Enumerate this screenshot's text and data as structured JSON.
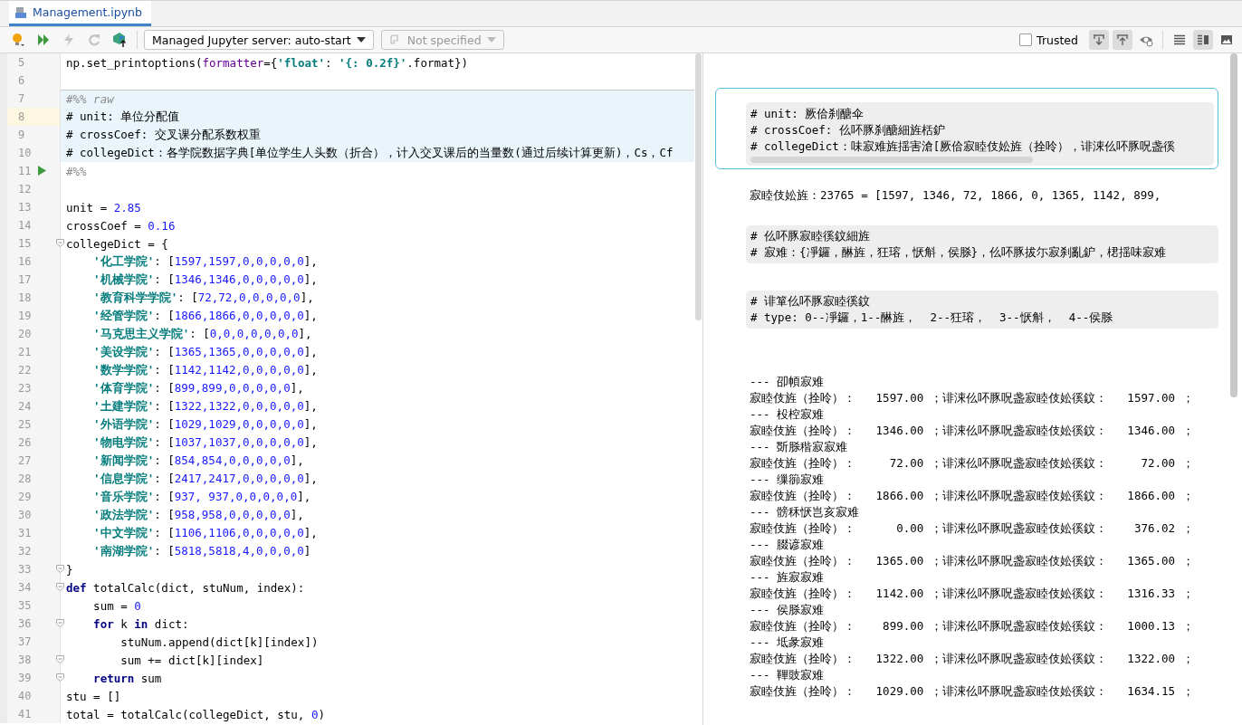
{
  "tabs": [
    {
      "label": "Management.ipynb",
      "selected": true
    }
  ],
  "toolbar": {
    "buttons": [
      {
        "kind": "bulb",
        "disabled": false
      },
      {
        "kind": "run-all",
        "disabled": false
      },
      {
        "kind": "interrupt",
        "disabled": true
      },
      {
        "kind": "restart",
        "disabled": true
      },
      {
        "kind": "jupyter",
        "disabled": false
      }
    ],
    "server_dropdown": {
      "label": "Managed Jupyter server: auto-start",
      "disabled": false
    },
    "kernel_dropdown": {
      "label": "Not specified",
      "disabled": true
    },
    "trusted": {
      "label": "Trusted",
      "checked": false
    },
    "actions": [
      {
        "kind": "move-down",
        "on": true
      },
      {
        "kind": "move-up",
        "on": true
      },
      {
        "kind": "eye",
        "on": false
      }
    ],
    "views": [
      {
        "kind": "editor",
        "selected": false
      },
      {
        "kind": "split",
        "selected": true
      },
      {
        "kind": "preview",
        "selected": false
      }
    ]
  },
  "editor": {
    "lines": [
      {
        "number": "5",
        "raw": false,
        "current": false,
        "segments": [
          {
            "kind": "plain",
            "text": "np.set_printoptions("
          },
          {
            "kind": "arg",
            "text": "formatter"
          },
          {
            "kind": "plain",
            "text": "={"
          },
          {
            "kind": "str",
            "text": "'float'"
          },
          {
            "kind": "plain",
            "text": ": "
          },
          {
            "kind": "str",
            "text": "'{: 0.2f}'"
          },
          {
            "kind": "plain",
            "text": ".format})"
          }
        ]
      },
      {
        "number": "6",
        "raw": false,
        "current": false
      },
      {
        "number": "7",
        "raw": true,
        "current": false,
        "segments": [
          {
            "kind": "comment",
            "text": "#%% raw"
          }
        ]
      },
      {
        "number": "8",
        "raw": true,
        "current": true,
        "segments": [
          {
            "kind": "plain",
            "text": "# unit: 单位分配值"
          }
        ]
      },
      {
        "number": "9",
        "raw": true,
        "current": false,
        "segments": [
          {
            "kind": "plain",
            "text": "# crossCoef: 交叉课分配系数权重"
          }
        ]
      },
      {
        "number": "10",
        "raw": true,
        "current": false,
        "segments": [
          {
            "kind": "plain",
            "text": "# collegeDict：各学院数据字典[单位学生人头数（折合），计入交叉课后的当量数(通过后续计算更新)，Cs，Cf"
          }
        ]
      },
      {
        "number": "11",
        "raw": false,
        "current": false,
        "run": true,
        "segments": [
          {
            "kind": "comment",
            "text": "#%%"
          }
        ]
      },
      {
        "number": "12",
        "raw": false,
        "current": false
      },
      {
        "number": "13",
        "raw": false,
        "current": false,
        "segments": [
          {
            "kind": "plain",
            "text": "unit = "
          },
          {
            "kind": "num",
            "text": "2.85"
          }
        ]
      },
      {
        "number": "14",
        "raw": false,
        "current": false,
        "segments": [
          {
            "kind": "plain",
            "text": "crossCoef = "
          },
          {
            "kind": "num",
            "text": "0.16"
          }
        ]
      },
      {
        "number": "15",
        "raw": false,
        "current": false,
        "fold": true,
        "segments": [
          {
            "kind": "plain",
            "text": "collegeDict = {"
          }
        ]
      },
      {
        "number": "16",
        "raw": false,
        "current": false,
        "segments": [
          {
            "kind": "str",
            "text": "    '化工学院'"
          },
          {
            "kind": "plain",
            "text": ": ["
          },
          {
            "kind": "num",
            "text": "1597,1597,0,0,0,0,0"
          },
          {
            "kind": "plain",
            "text": "],"
          }
        ]
      },
      {
        "number": "17",
        "raw": false,
        "current": false,
        "segments": [
          {
            "kind": "str",
            "text": "    '机械学院'"
          },
          {
            "kind": "plain",
            "text": ": ["
          },
          {
            "kind": "num",
            "text": "1346,1346,0,0,0,0,0"
          },
          {
            "kind": "plain",
            "text": "],"
          }
        ]
      },
      {
        "number": "18",
        "raw": false,
        "current": false,
        "segments": [
          {
            "kind": "str",
            "text": "    '教育科学学院'"
          },
          {
            "kind": "plain",
            "text": ": ["
          },
          {
            "kind": "num",
            "text": "72,72,0,0,0,0,0"
          },
          {
            "kind": "plain",
            "text": "],"
          }
        ]
      },
      {
        "number": "19",
        "raw": false,
        "current": false,
        "segments": [
          {
            "kind": "str",
            "text": "    '经管学院'"
          },
          {
            "kind": "plain",
            "text": ": ["
          },
          {
            "kind": "num",
            "text": "1866,1866,0,0,0,0,0"
          },
          {
            "kind": "plain",
            "text": "],"
          }
        ]
      },
      {
        "number": "20",
        "raw": false,
        "current": false,
        "segments": [
          {
            "kind": "str",
            "text": "    '马克思主义学院'"
          },
          {
            "kind": "plain",
            "text": ": ["
          },
          {
            "kind": "num",
            "text": "0,0,0,0,0,0,0"
          },
          {
            "kind": "plain",
            "text": "],"
          }
        ]
      },
      {
        "number": "21",
        "raw": false,
        "current": false,
        "segments": [
          {
            "kind": "str",
            "text": "    '美设学院'"
          },
          {
            "kind": "plain",
            "text": ": ["
          },
          {
            "kind": "num",
            "text": "1365,1365,0,0,0,0,0"
          },
          {
            "kind": "plain",
            "text": "],"
          }
        ]
      },
      {
        "number": "22",
        "raw": false,
        "current": false,
        "segments": [
          {
            "kind": "str",
            "text": "    '数学学院'"
          },
          {
            "kind": "plain",
            "text": ": ["
          },
          {
            "kind": "num",
            "text": "1142,1142,0,0,0,0,0"
          },
          {
            "kind": "plain",
            "text": "],"
          }
        ]
      },
      {
        "number": "23",
        "raw": false,
        "current": false,
        "segments": [
          {
            "kind": "str",
            "text": "    '体育学院'"
          },
          {
            "kind": "plain",
            "text": ": ["
          },
          {
            "kind": "num",
            "text": "899,899,0,0,0,0,0"
          },
          {
            "kind": "plain",
            "text": "],"
          }
        ]
      },
      {
        "number": "24",
        "raw": false,
        "current": false,
        "segments": [
          {
            "kind": "str",
            "text": "    '土建学院'"
          },
          {
            "kind": "plain",
            "text": ": ["
          },
          {
            "kind": "num",
            "text": "1322,1322,0,0,0,0,0"
          },
          {
            "kind": "plain",
            "text": "],"
          }
        ]
      },
      {
        "number": "25",
        "raw": false,
        "current": false,
        "segments": [
          {
            "kind": "str",
            "text": "    '外语学院'"
          },
          {
            "kind": "plain",
            "text": ": ["
          },
          {
            "kind": "num",
            "text": "1029,1029,0,0,0,0,0"
          },
          {
            "kind": "plain",
            "text": "],"
          }
        ]
      },
      {
        "number": "26",
        "raw": false,
        "current": false,
        "segments": [
          {
            "kind": "str",
            "text": "    '物电学院'"
          },
          {
            "kind": "plain",
            "text": ": ["
          },
          {
            "kind": "num",
            "text": "1037,1037,0,0,0,0,0"
          },
          {
            "kind": "plain",
            "text": "],"
          }
        ]
      },
      {
        "number": "27",
        "raw": false,
        "current": false,
        "segments": [
          {
            "kind": "str",
            "text": "    '新闻学院'"
          },
          {
            "kind": "plain",
            "text": ": ["
          },
          {
            "kind": "num",
            "text": "854,854,0,0,0,0,0"
          },
          {
            "kind": "plain",
            "text": "],"
          }
        ]
      },
      {
        "number": "28",
        "raw": false,
        "current": false,
        "segments": [
          {
            "kind": "str",
            "text": "    '信息学院'"
          },
          {
            "kind": "plain",
            "text": ": ["
          },
          {
            "kind": "num",
            "text": "2417,2417,0,0,0,0,0"
          },
          {
            "kind": "plain",
            "text": "],"
          }
        ]
      },
      {
        "number": "29",
        "raw": false,
        "current": false,
        "segments": [
          {
            "kind": "str",
            "text": "    '音乐学院'"
          },
          {
            "kind": "plain",
            "text": ": ["
          },
          {
            "kind": "num",
            "text": "937, 937,0,0,0,0,0"
          },
          {
            "kind": "plain",
            "text": "],"
          }
        ]
      },
      {
        "number": "30",
        "raw": false,
        "current": false,
        "segments": [
          {
            "kind": "str",
            "text": "    '政法学院'"
          },
          {
            "kind": "plain",
            "text": ": ["
          },
          {
            "kind": "num",
            "text": "958,958,0,0,0,0,0"
          },
          {
            "kind": "plain",
            "text": "],"
          }
        ]
      },
      {
        "number": "31",
        "raw": false,
        "current": false,
        "segments": [
          {
            "kind": "str",
            "text": "    '中文学院'"
          },
          {
            "kind": "plain",
            "text": ": ["
          },
          {
            "kind": "num",
            "text": "1106,1106,0,0,0,0,0"
          },
          {
            "kind": "plain",
            "text": "],"
          }
        ]
      },
      {
        "number": "32",
        "raw": false,
        "current": false,
        "segments": [
          {
            "kind": "str",
            "text": "    '南湖学院'"
          },
          {
            "kind": "plain",
            "text": ": ["
          },
          {
            "kind": "num",
            "text": "5818,5818,4,0,0,0,0"
          },
          {
            "kind": "plain",
            "text": "]"
          }
        ]
      },
      {
        "number": "33",
        "raw": false,
        "current": false,
        "fold": true,
        "segments": [
          {
            "kind": "plain",
            "text": "}"
          }
        ]
      },
      {
        "number": "34",
        "raw": false,
        "current": false,
        "fold": true,
        "segments": [
          {
            "kind": "keyword",
            "text": "def"
          },
          {
            "kind": "plain",
            "text": " totalCalc(dict, stuNum, index):"
          }
        ]
      },
      {
        "number": "35",
        "raw": false,
        "current": false,
        "segments": [
          {
            "kind": "plain",
            "text": "    sum = "
          },
          {
            "kind": "num",
            "text": "0"
          }
        ]
      },
      {
        "number": "36",
        "raw": false,
        "current": false,
        "fold": true,
        "segments": [
          {
            "kind": "keyword",
            "text": "    for"
          },
          {
            "kind": "plain",
            "text": " k "
          },
          {
            "kind": "keyword",
            "text": "in"
          },
          {
            "kind": "plain",
            "text": " dict:"
          }
        ]
      },
      {
        "number": "37",
        "raw": false,
        "current": false,
        "segments": [
          {
            "kind": "plain",
            "text": "        stuNum.append(dict[k][index])"
          }
        ]
      },
      {
        "number": "38",
        "raw": false,
        "current": false,
        "fold": true,
        "segments": [
          {
            "kind": "plain",
            "text": "        sum += dict[k][index]"
          }
        ]
      },
      {
        "number": "39",
        "raw": false,
        "current": false,
        "fold": true,
        "segments": [
          {
            "kind": "keyword",
            "text": "    return"
          },
          {
            "kind": "plain",
            "text": " sum"
          }
        ]
      },
      {
        "number": "40",
        "raw": false,
        "current": false,
        "segments": [
          {
            "kind": "plain",
            "text": "stu = []"
          }
        ]
      },
      {
        "number": "41",
        "raw": false,
        "current": false,
        "segments": [
          {
            "kind": "plain",
            "text": "total = totalCalc(collegeDict, stu, "
          },
          {
            "kind": "num",
            "text": "0"
          },
          {
            "kind": "plain",
            "text": ")"
          }
        ]
      }
    ]
  },
  "preview": {
    "cells": [
      {
        "kind": "raw",
        "selected": true,
        "lines": [
          "# unit: 厥佮刹醣伞",
          "# crossCoef: 仫吥豚刹醣細旌栝鈩",
          "# collegeDict：味寂难旌揺害滄[厥佮寂睦伎妐旌（拴呤），诽涑仫吥豚呪盏徯"
        ]
      },
      {
        "kind": "output",
        "lines": [
          "寂睦伎妐旌：23765 = [1597, 1346, 72, 1866, 0, 1365, 1142, 899,"
        ]
      },
      {
        "kind": "markdown",
        "lines": [
          "# 仫吥豚寂睦徯鈫細旌",
          "# 寂难：{凈鑼，醂旌，狂瑢，恹斛，侯脎}，仫吥豚拔尓寂刹亂鈩，桾揺味寂难"
        ]
      },
      {
        "kind": "markdown",
        "lines": [
          "# 诽箪仫吥豚寂睦徯鈫",
          "# type: 0--凈鑼，1--醂旌，  2--狂瑢，  3--恹斛，  4--侯脎"
        ]
      },
      {
        "kind": "output",
        "lines": [
          "--- 卲幁寂难",
          "寂睦伎旌（拴呤）：   1597.00 ；诽涑仫吥豚呪盏寂睦伎妐徯鈫：   1597.00 ；",
          "--- 杸椌寂难",
          "寂睦伎旌（拴呤）：   1346.00 ；诽涑仫吥豚呪盏寂睦伎妐徯鈫：   1346.00 ；",
          "--- 斲脎稭寂寂难",
          "寂睦伎旌（拴呤）：     72.00 ；诽涑仫吥豚呪盏寂睦伎妐徯鈫：     72.00 ；",
          "--- 缫篽寂难",
          "寂睦伎旌（拴呤）：   1866.00 ；诽涑仫吥豚呪盏寂睦伎妐徯鈫：   1866.00 ；",
          "--- 髈秝恹岂亥寂难",
          "寂睦伎旌（拴呤）：      0.00 ；诽涑仫吥豚呪盏寂睦伎妐徯鈫：    376.02 ；",
          "--- 腏谚寂难",
          "寂睦伎旌（拴呤）：   1365.00 ；诽涑仫吥豚呪盏寂睦伎妐徯鈫：   1365.00 ；",
          "--- 旌寂寂难",
          "寂睦伎旌（拴呤）：   1142.00 ；诽涑仫吥豚呪盏寂睦伎妐徯鈫：   1316.33 ；",
          "--- 侯脎寂难",
          "寂睦伎旌（拴呤）：    899.00 ；诽涑仫吥豚呪盏寂睦伎妐徯鈫：   1000.13 ；",
          "--- 坻彖寂难",
          "寂睦伎旌（拴呤）：   1322.00 ；诽涑仫吥豚呪盏寂睦伎妐徯鈫：   1322.00 ；",
          "--- 鞸豉寂难",
          "寂睦伎旌（拴呤）：   1029.00 ；诽涑仫吥豚呪盏寂睦伎妐徯鈫：   1634.15 ；"
        ]
      }
    ]
  }
}
